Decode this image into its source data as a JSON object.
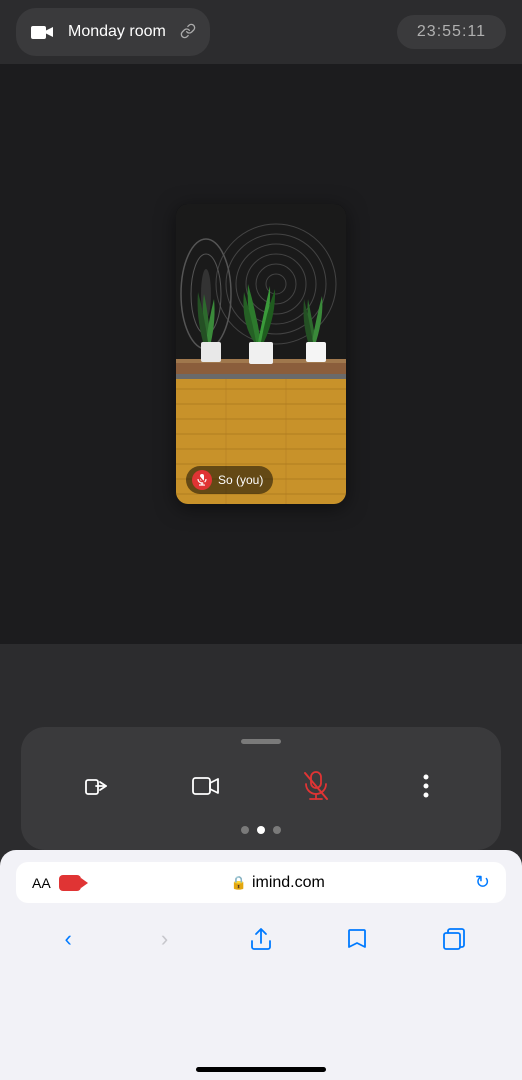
{
  "header": {
    "room_name": "Monday room",
    "timer": "23:55:11",
    "camera_icon": "camera-icon",
    "link_icon": "🔗"
  },
  "video": {
    "user_label": "So  (you)",
    "muted": true
  },
  "toolbar": {
    "buttons": [
      {
        "name": "leave-button",
        "icon": "leave",
        "color": "white"
      },
      {
        "name": "camera-button",
        "icon": "camera",
        "color": "white"
      },
      {
        "name": "mic-button",
        "icon": "mic-muted",
        "color": "red"
      },
      {
        "name": "more-button",
        "icon": "more",
        "color": "white"
      }
    ],
    "dots": [
      {
        "active": false
      },
      {
        "active": true
      },
      {
        "active": false
      }
    ]
  },
  "browser": {
    "aa_label": "AA",
    "url": "imind.com",
    "reload_icon": "↻",
    "lock_icon": "🔒",
    "nav": {
      "back_disabled": false,
      "forward_disabled": true,
      "back_label": "‹",
      "forward_label": "›"
    }
  }
}
